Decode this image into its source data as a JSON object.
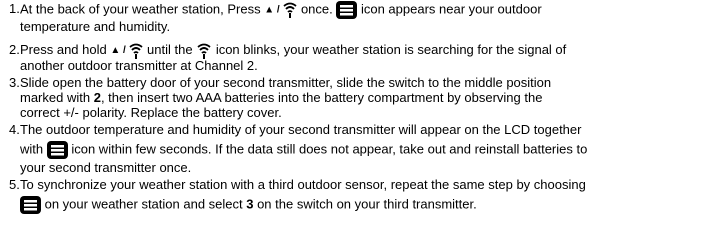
{
  "steps": [
    {
      "number": "1.",
      "line1_a": "At the back of your weather station, Press ",
      "line1_b": " once. ",
      "line1_c": " icon appears near your outdoor",
      "line2": "temperature and humidity."
    },
    {
      "number": "2.",
      "line1_a": "Press and hold ",
      "line1_b": " until the ",
      "line1_c": " icon blinks, your weather station is searching for the signal of",
      "line2": "another outdoor transmitter at Channel 2."
    },
    {
      "number": "3.",
      "line1": "Slide open the battery door of your second transmitter, slide the switch to the middle position",
      "line2_a": "marked with ",
      "line2_b": "2",
      "line2_c": ", then insert two AAA batteries into the battery compartment by observing the",
      "line3": "correct +/- polarity. Replace the battery cover."
    },
    {
      "number": "4.",
      "line1": "The outdoor temperature and humidity of your second transmitter will appear on the LCD together",
      "line2_a": "with ",
      "line2_b": " icon within few seconds. If the data still does not appear, take out and reinstall batteries to",
      "line3": "your second transmitter once."
    },
    {
      "number": "5.",
      "line1": "To synchronize your weather station with a third outdoor sensor, repeat the same step by choosing",
      "line2_a": " on your weather station and select ",
      "line2_b": "3",
      "line2_c": " on the switch on your third transmitter."
    }
  ],
  "button_glyph": "▲ /",
  "icons": [
    "up-arrow-glyph",
    "signal-wave-icon",
    "channel-display-icon"
  ]
}
